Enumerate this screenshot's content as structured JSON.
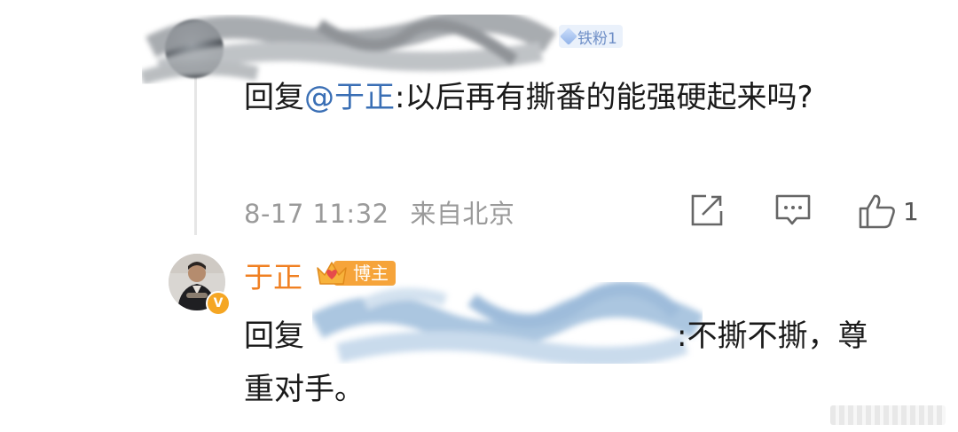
{
  "comment": {
    "user_badge": "铁粉1",
    "reply_prefix": "回复",
    "mention": "@于正",
    "reply_body": ":以后再有撕番的能强硬起来吗?",
    "timestamp": "8-17 11:32",
    "location": "来自北京",
    "like_count": "1"
  },
  "author_reply": {
    "author_name": "于正",
    "author_badge": "博主",
    "verify_mark": "V",
    "reply_prefix": "回复",
    "reply_body": ":不撕不撕，尊重对手。"
  },
  "colors": {
    "mention": "#3a6fb5",
    "author_name": "#f08022",
    "host_badge": "#f6a43a",
    "meta_text": "#9a9a9a"
  },
  "icons": [
    "share-icon",
    "comment-icon",
    "like-icon",
    "crown-icon",
    "verified-icon"
  ]
}
